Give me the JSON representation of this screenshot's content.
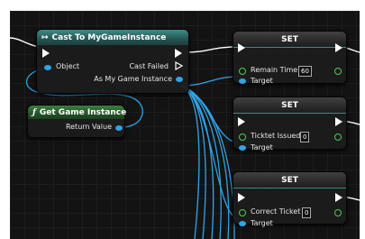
{
  "cast_node": {
    "title": "Cast To MyGameInstance",
    "title_icon": "cast-arrow-icon",
    "object_pin": "Object",
    "cast_failed_pin": "Cast Failed",
    "as_pin": "As My Game Instance"
  },
  "get_instance_node": {
    "title": "Get Game Instance",
    "title_icon": "function-icon",
    "return_pin": "Return Value"
  },
  "set_nodes": [
    {
      "title": "SET",
      "variable": "Remain Time",
      "value": "60",
      "target_pin": "Target"
    },
    {
      "title": "SET",
      "variable": "Ticktet Issued",
      "value": "0",
      "target_pin": "Target"
    },
    {
      "title": "SET",
      "variable": "Correct Ticket",
      "value": "0",
      "target_pin": "Target"
    }
  ],
  "colors": {
    "background": "#131313",
    "object_pin": "#32a3e5",
    "int_pin": "#4fcc4f",
    "exec_wire": "#ffffff",
    "cast_header": "#2d6f6a",
    "function_header": "#2e6a32"
  }
}
